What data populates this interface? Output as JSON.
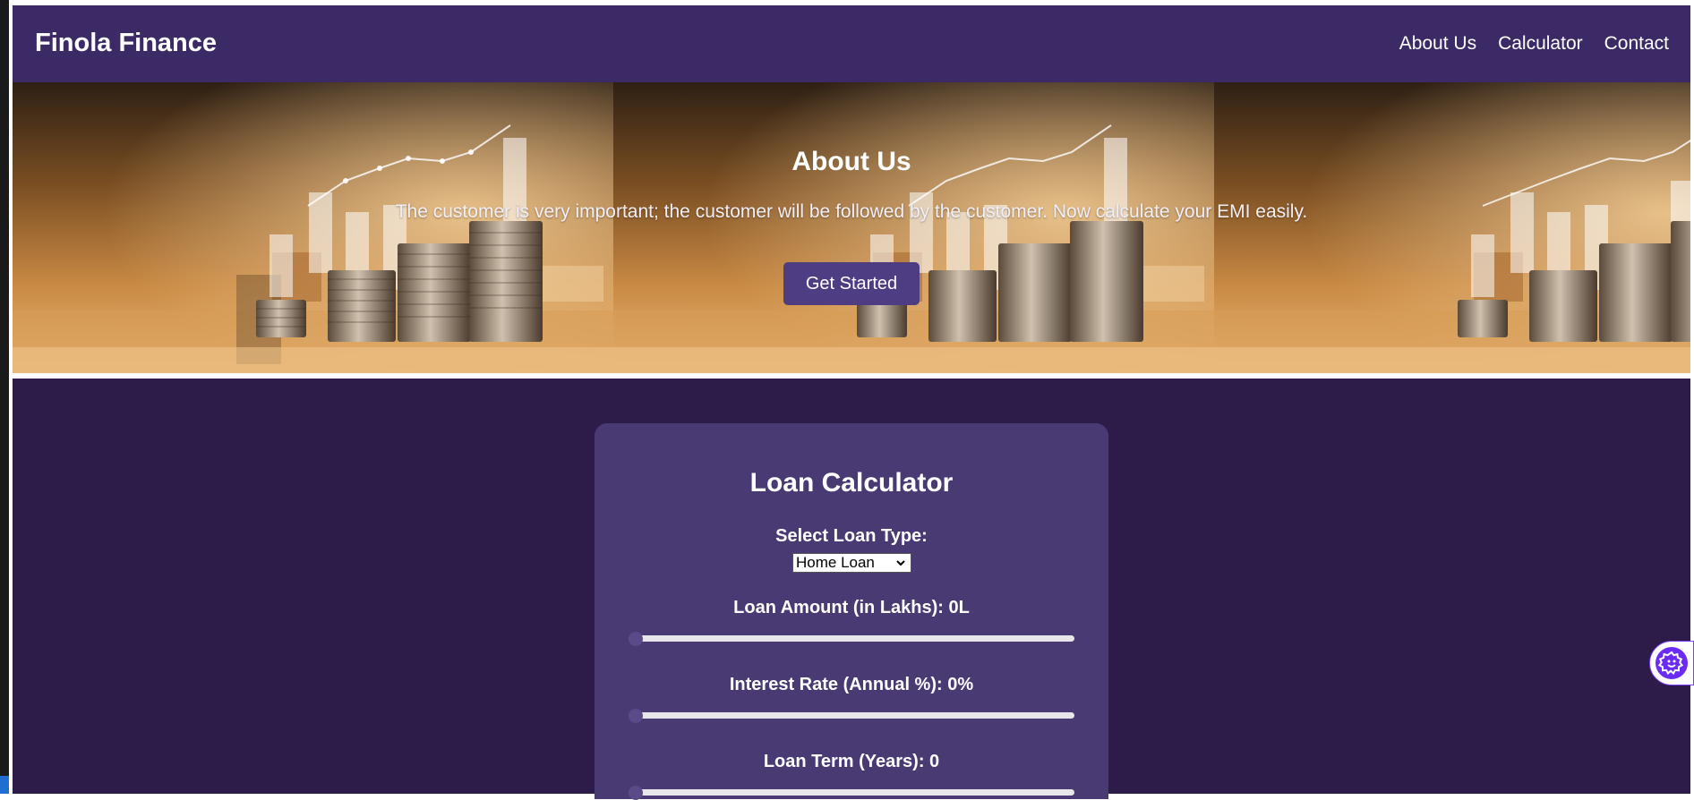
{
  "nav": {
    "brand": "Finola Finance",
    "links": [
      "About Us",
      "Calculator",
      "Contact"
    ]
  },
  "hero": {
    "title": "About Us",
    "text": "The customer is very important; the customer will be followed by the customer. Now calculate your EMI easily.",
    "cta_label": "Get Started"
  },
  "calculator": {
    "title": "Loan Calculator",
    "loan_type_label": "Select Loan Type:",
    "loan_type_selected": "Home Loan",
    "amount_label": "Loan Amount (in Lakhs): 0L",
    "amount_value": 0,
    "rate_label": "Interest Rate (Annual %): 0%",
    "rate_value": 0,
    "term_label": "Loan Term (Years): 0",
    "term_value": 0
  },
  "colors": {
    "nav_bg": "#3b2a66",
    "page_bg": "#2d1b49",
    "card_bg": "#4a3a73",
    "button_bg": "#4f3d84",
    "widget_accent": "#6a2cf5"
  },
  "icons": {
    "dropdown": "chevron-down-icon",
    "widget": "gear-smile-icon"
  }
}
